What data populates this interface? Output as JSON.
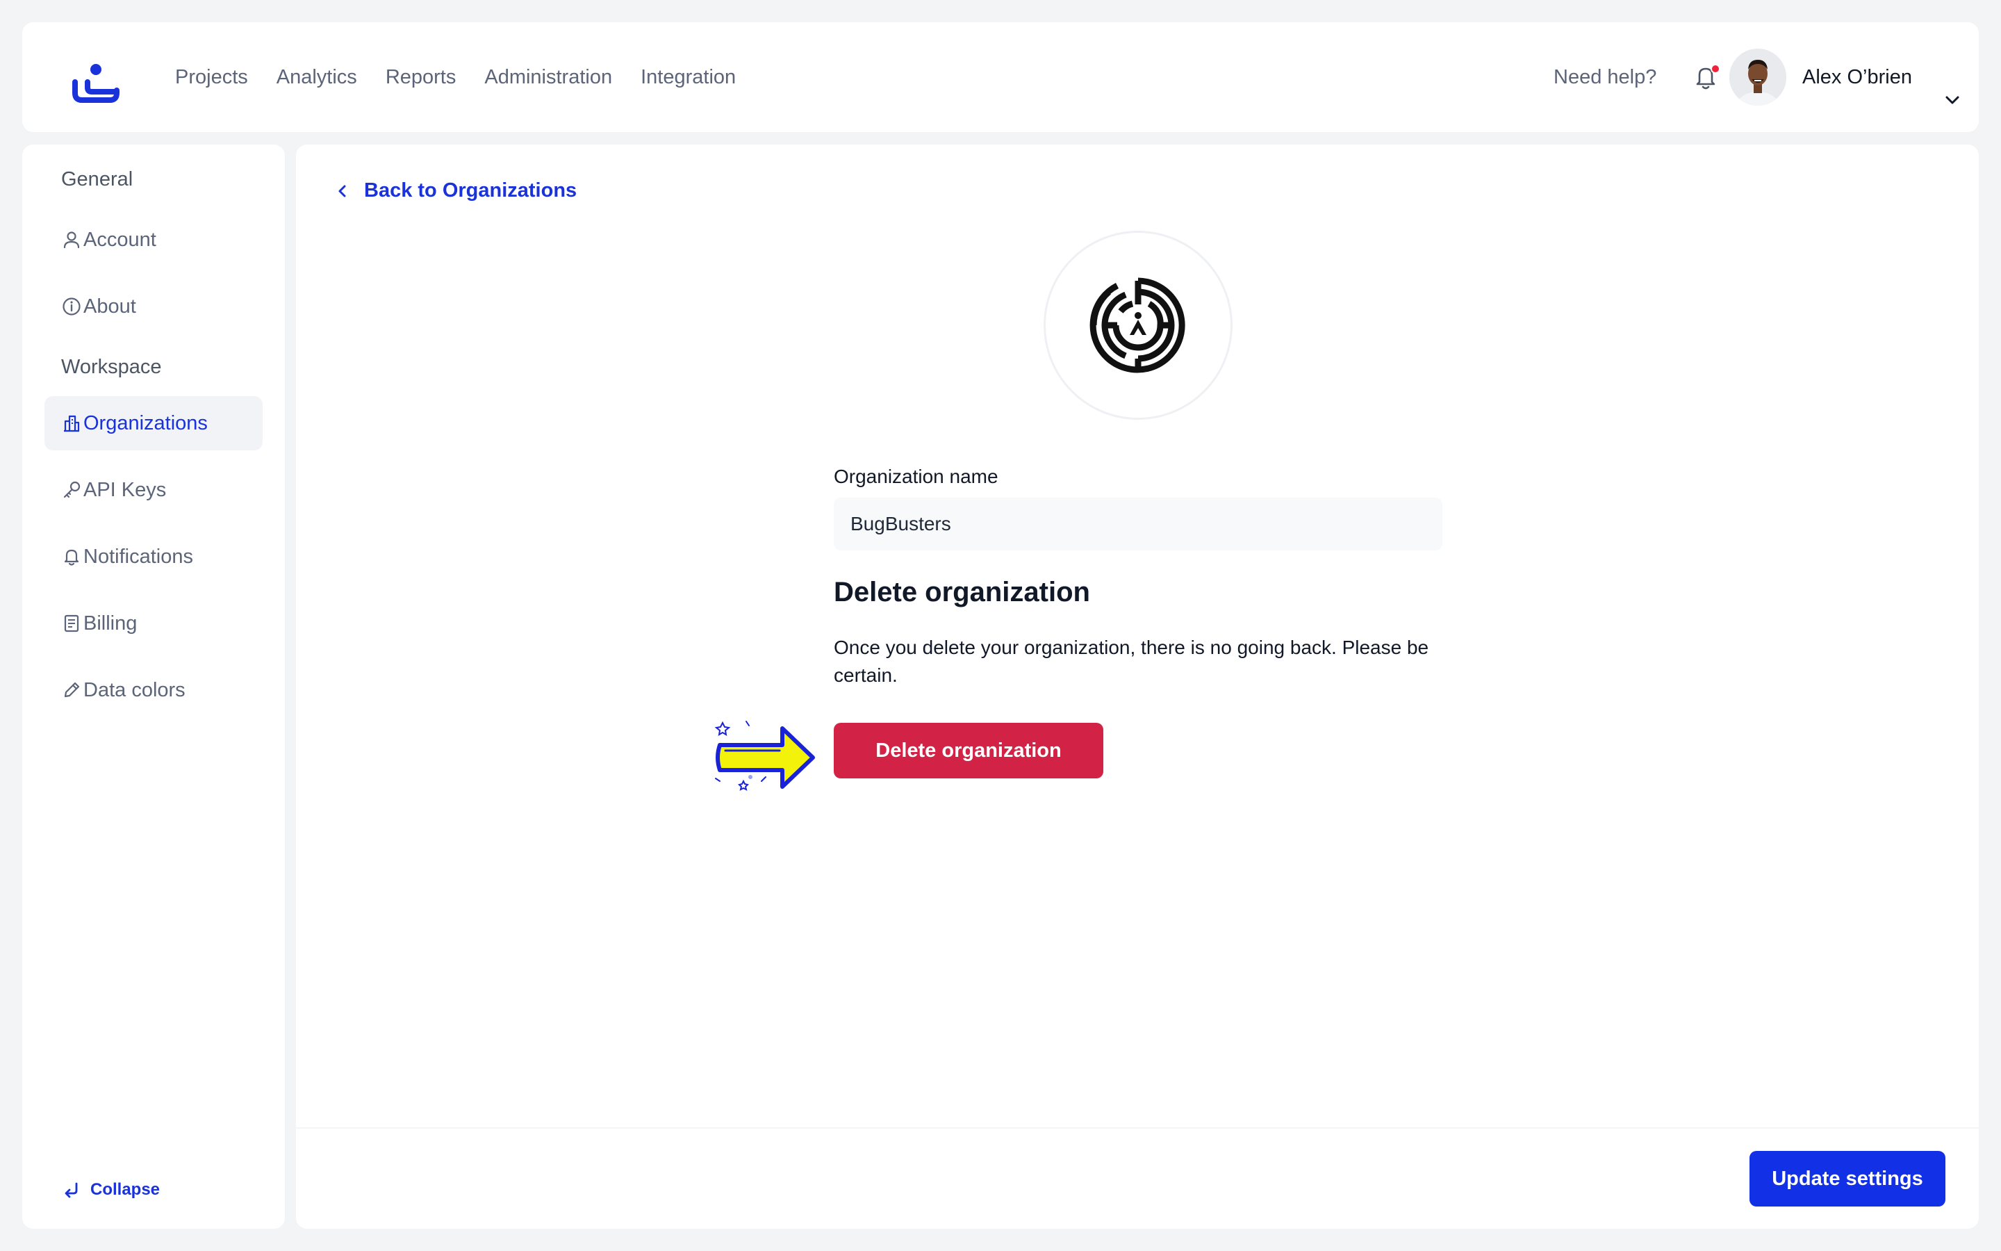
{
  "header": {
    "nav": [
      "Projects",
      "Analytics",
      "Reports",
      "Administration",
      "Integration"
    ],
    "help": "Need help?",
    "user_name": "Alex O’brien"
  },
  "sidebar": {
    "sections": [
      {
        "title": "General",
        "items": [
          {
            "label": "Account",
            "icon": "user-icon"
          },
          {
            "label": "About",
            "icon": "info-icon"
          }
        ]
      },
      {
        "title": "Workspace",
        "items": [
          {
            "label": "Organizations",
            "icon": "building-icon",
            "active": true
          },
          {
            "label": "API Keys",
            "icon": "key-icon"
          },
          {
            "label": "Notifications",
            "icon": "bell-icon"
          },
          {
            "label": "Billing",
            "icon": "document-icon"
          },
          {
            "label": "Data colors",
            "icon": "pencil-icon"
          }
        ]
      }
    ],
    "collapse": "Collapse"
  },
  "main": {
    "back": "Back to Organizations",
    "org_name_label": "Organization name",
    "org_name_value": "BugBusters",
    "delete_title": "Delete organization",
    "delete_text": "Once you delete your organization, there is no going back. Please be certain.",
    "delete_button": "Delete organization",
    "update_button": "Update settings"
  },
  "colors": {
    "accent": "#1a32d9",
    "danger": "#d22246",
    "primary_button": "#1230e6",
    "notification_dot": "#ef233c",
    "highlight_arrow": "#f2f20a"
  }
}
